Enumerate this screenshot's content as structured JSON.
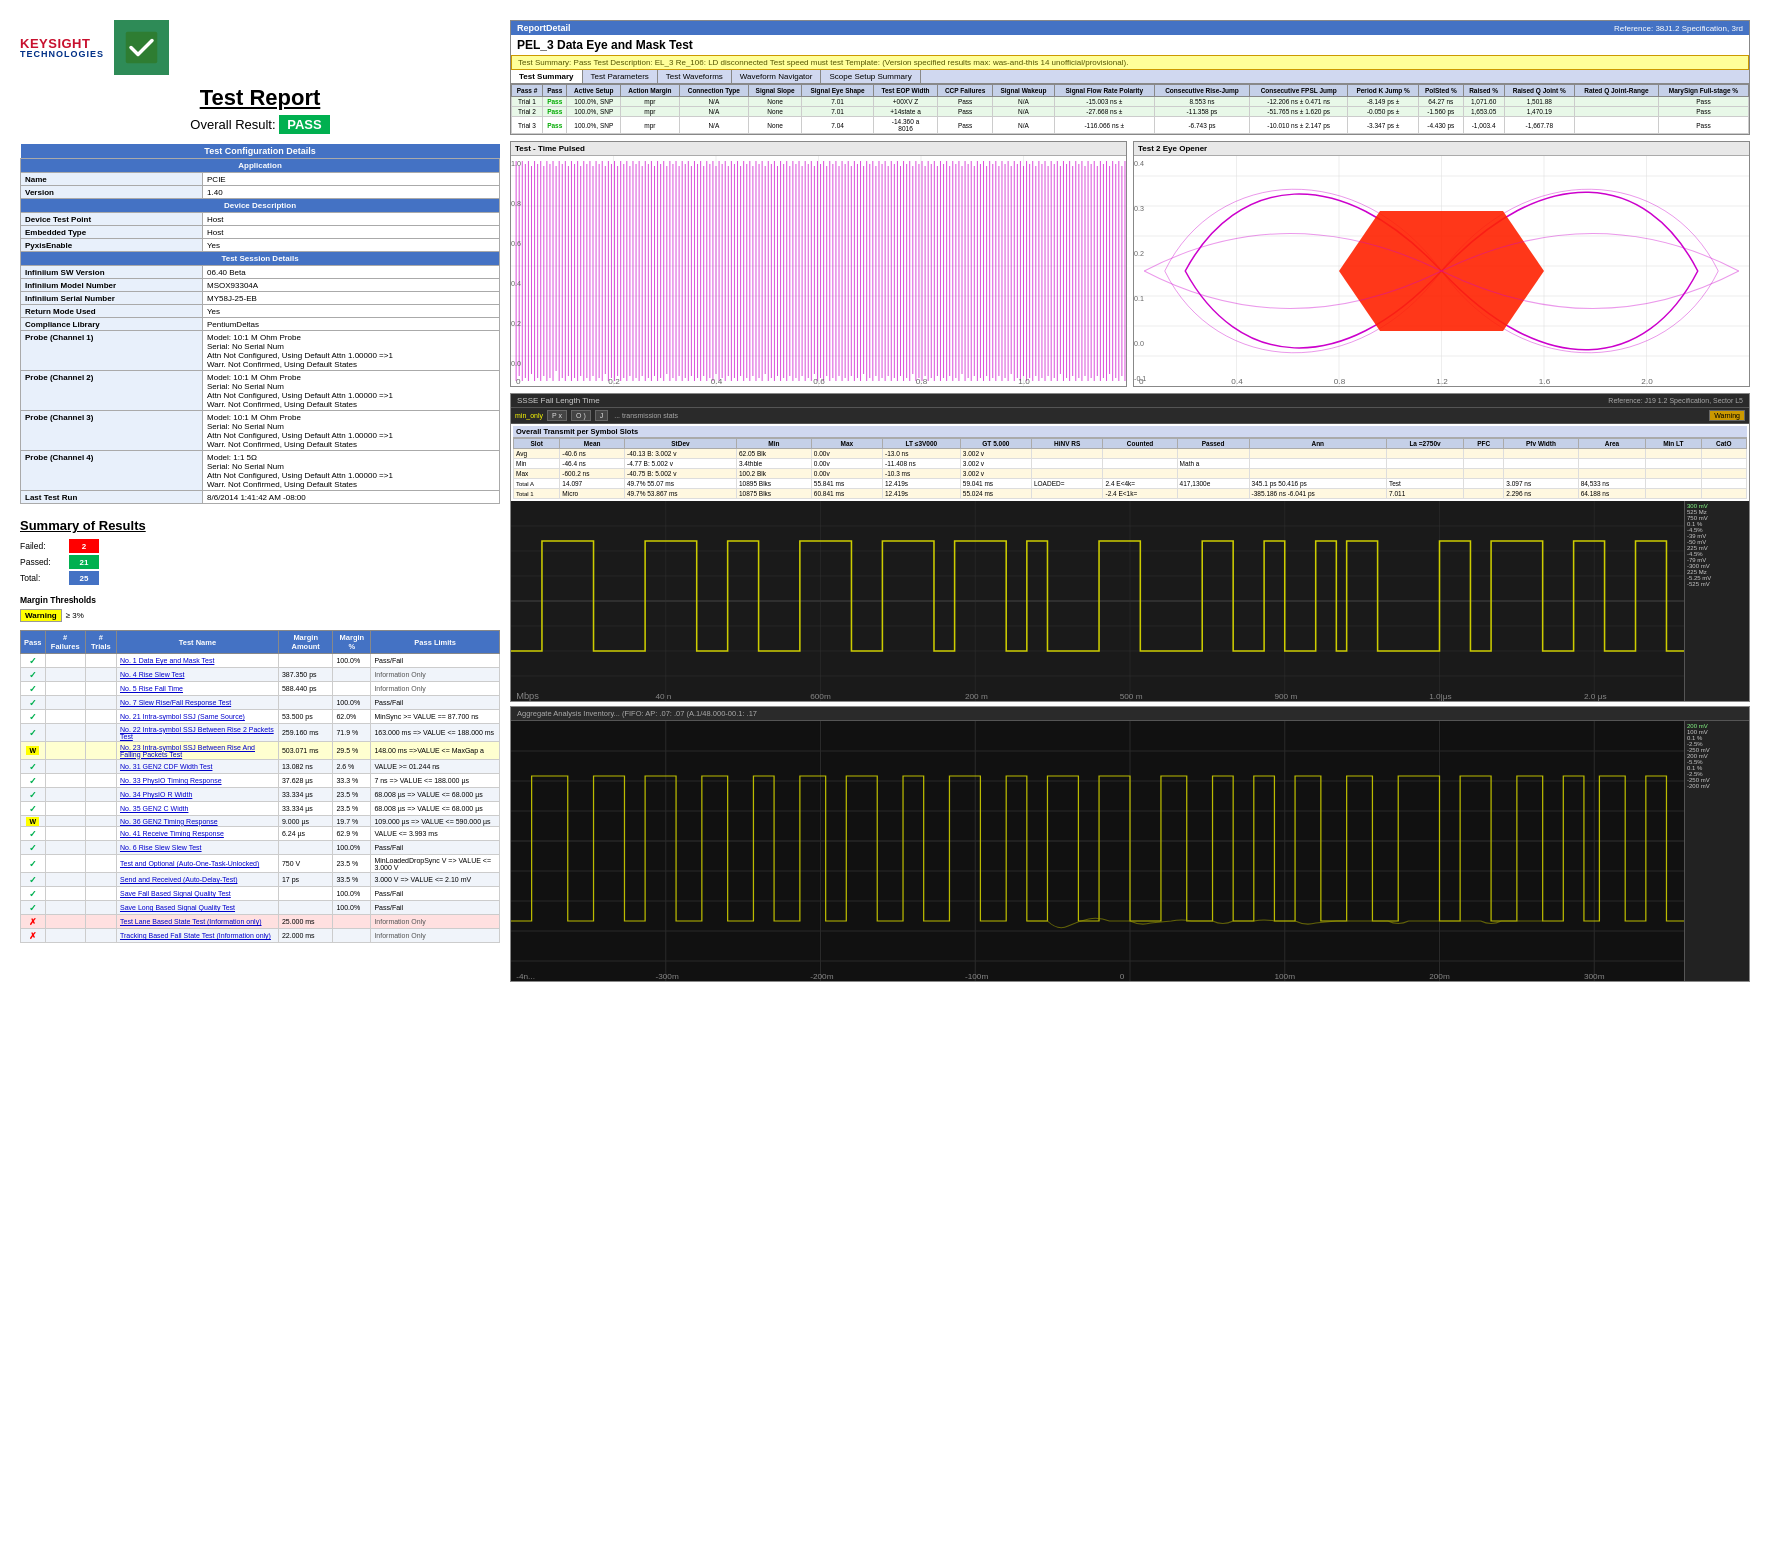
{
  "header": {
    "title": "Test Report",
    "overall_label": "Overall Result:",
    "overall_value": "PASS"
  },
  "config": {
    "table_header": "Test Configuration Details",
    "section_application": "Application",
    "fields": [
      {
        "label": "Name",
        "value": "PCIE"
      },
      {
        "label": "Version",
        "value": "1.40"
      },
      {
        "section": "Device Description"
      },
      {
        "label": "Device Test Point",
        "value": "Host"
      },
      {
        "label": "Embedded Type",
        "value": "Host"
      },
      {
        "label": "PyxisEnable",
        "value": "Yes"
      },
      {
        "section": "Test Session Details"
      },
      {
        "label": "Infiniium SW Version",
        "value": "06.40 Beta"
      },
      {
        "label": "Infiniium Model Number",
        "value": "MSOX93304A"
      },
      {
        "label": "Infiniium Serial Number",
        "value": "MY58J-25-EB"
      },
      {
        "label": "Return Mode Used",
        "value": "Yes"
      },
      {
        "label": "Compliance Library",
        "value": "PentiumDeltas"
      },
      {
        "label": "Probe (Channel 1)",
        "value": "Model: 10:1 M Ohm Probe\nSerial: No Serial Num\nAttn Not Configured, Using Default Attn 1.00000 =>1\nWarr. Not Confirmed, Using Default States"
      },
      {
        "label": "Probe (Channel 2)",
        "value": "Model: 10:1 M Ohm Probe\nSerial: No Serial Num\nAttn Not Configured, Using Default Attn 1.00000 =>1\nWarr. Not Confirmed, Using Default States"
      },
      {
        "label": "Probe (Channel 3)",
        "value": "Model: 10:1 M Ohm Probe\nSerial: No Serial Num\nAttn Not Configured, Using Default Attn 1.00000 =>1\nWarr. Not Confirmed, Using Default States"
      },
      {
        "label": "Probe (Channel 4)",
        "value": "Model: 1:1 5Ω\nSerial: No Serial Num\nAttn Not Configured, Using Default Attn 1.00000 =>1\nWarr. Not Confirmed, Using Default States"
      },
      {
        "label": "Last Test Run",
        "value": "8/6/2014 1:41:42 AM -08:00"
      }
    ]
  },
  "summary": {
    "title": "Summary of Results",
    "counts": [
      {
        "label": "Failed:",
        "value": "2",
        "color": "red"
      },
      {
        "label": "Passed:",
        "value": "21",
        "color": "green"
      },
      {
        "label": "Total:",
        "value": "25",
        "color": "blue"
      }
    ],
    "margin_threshold_label": "Margin Thresholds",
    "warning_label": "Warning",
    "warning_pct": "≥ 3%"
  },
  "results_table": {
    "headers": [
      "Pass",
      "# Failures",
      "# Trials",
      "Test Name",
      "Margin Amount",
      "Margin %",
      "Pass Limits"
    ],
    "rows": [
      {
        "pass": "✓",
        "failures": "",
        "trials": "",
        "name": "No. 1 Data Eye and Mask Test",
        "margin_amt": "",
        "margin_pct": "100.0%",
        "limits": "Pass/Fail",
        "status": "pass"
      },
      {
        "pass": "✓",
        "failures": "",
        "trials": "",
        "name": "No. 4 Rise Slew Test",
        "margin_amt": "387.350 ps",
        "margin_pct": "",
        "limits": "Information Only",
        "status": "pass"
      },
      {
        "pass": "✓",
        "failures": "",
        "trials": "",
        "name": "No. 5 Rise Fall Time",
        "margin_amt": "588.440 ps",
        "margin_pct": "",
        "limits": "Information Only",
        "status": "pass"
      },
      {
        "pass": "✓",
        "failures": "",
        "trials": "",
        "name": "No. 7 Slew Rise/Fall Response Test",
        "margin_amt": "",
        "margin_pct": "100.0%",
        "limits": "Pass/Fail",
        "status": "pass"
      },
      {
        "pass": "✓",
        "failures": "",
        "trials": "",
        "name": "No. 21 Intra-symbol SSJ (Same Source)",
        "margin_amt": "53.500 ps",
        "margin_pct": "62.0%",
        "limits": "MinSync >= VALUE == 87.700 ns",
        "status": "pass"
      },
      {
        "pass": "✓",
        "failures": "",
        "trials": "",
        "name": "No. 22 Intra-symbol SSJ Between Rise 2 Packets Test",
        "margin_amt": "259.160 ms",
        "margin_pct": "71.9 %",
        "limits": "163.000 ms => VALUE <= 188.000 ms",
        "status": "pass"
      },
      {
        "pass": "W",
        "failures": "",
        "trials": "",
        "name": "No. 23 Intra-symbol SSJ Between Rise And Falling Packets Test",
        "margin_amt": "503.071 ms",
        "margin_pct": "29.5 %",
        "limits": "148.00 ms =>VALUE <= MaxGap a",
        "status": "warn"
      },
      {
        "pass": "✓",
        "failures": "",
        "trials": "",
        "name": "No. 31 GEN2 CDF Width Test",
        "margin_amt": "13.082 ns",
        "margin_pct": "2.6 %",
        "limits": "VALUE >= 01.244 ns",
        "status": "pass"
      },
      {
        "pass": "✓",
        "failures": "",
        "trials": "",
        "name": "No. 33 PhysIO Timing Response",
        "margin_amt": "37.628 µs",
        "margin_pct": "33.3 %",
        "limits": "7 ns => VALUE <= 188.000 µs",
        "status": "pass"
      },
      {
        "pass": "✓",
        "failures": "",
        "trials": "",
        "name": "No. 34 PhysIO R Width",
        "margin_amt": "33.334 µs",
        "margin_pct": "23.5 %",
        "limits": "68.008 µs => VALUE <= 68.000 µs",
        "status": "pass"
      },
      {
        "pass": "✓",
        "failures": "",
        "trials": "",
        "name": "No. 35 GEN2 C Width",
        "margin_amt": "33.334 µs",
        "margin_pct": "23.5 %",
        "limits": "68.008 µs => VALUE <= 68.000 µs",
        "status": "pass"
      },
      {
        "pass": "W",
        "failures": "",
        "trials": "",
        "name": "No. 36 GEN2 Timing Response",
        "margin_amt": "9.000 µs",
        "margin_pct": "19.7 %",
        "limits": "109.000 µs => VALUE <= 590.000 µs",
        "status": "warn"
      },
      {
        "pass": "✓",
        "failures": "",
        "trials": "",
        "name": "No. 41 Receive Timing Response",
        "margin_amt": "6.24 µs",
        "margin_pct": "62.9 %",
        "limits": "VALUE <= 3.993 ms",
        "status": "pass"
      },
      {
        "pass": "✓",
        "failures": "",
        "trials": "",
        "name": "No. 6 Rise Slew Slew Test",
        "margin_amt": "",
        "margin_pct": "100.0%",
        "limits": "Pass/Fail",
        "status": "pass"
      },
      {
        "pass": "✓",
        "failures": "",
        "trials": "",
        "name": "Test and Optional (Auto-One-Task-Unlocked)",
        "margin_amt": "750 V",
        "margin_pct": "23.5 %",
        "limits": "MinLoadedDropSync V => VALUE <= 3.000 V",
        "status": "pass"
      },
      {
        "pass": "✓",
        "failures": "",
        "trials": "",
        "name": "Send and Received (Auto-Delay-Test)",
        "margin_amt": "17 ps",
        "margin_pct": "33.5 %",
        "limits": "3.000 V => VALUE <= 2.10 mV",
        "status": "pass"
      },
      {
        "pass": "✓",
        "failures": "",
        "trials": "",
        "name": "Save Fall Based Signal Quality Test",
        "margin_amt": "",
        "margin_pct": "100.0%",
        "limits": "Pass/Fail",
        "status": "pass"
      },
      {
        "pass": "✓",
        "failures": "",
        "trials": "",
        "name": "Save Long Based Signal Quality Test",
        "margin_amt": "",
        "margin_pct": "100.0%",
        "limits": "Pass/Fail",
        "status": "pass"
      },
      {
        "pass": "X",
        "failures": "",
        "trials": "",
        "name": "Test Lane Based State Test (Information only)",
        "margin_amt": "25.000 ms",
        "margin_pct": "",
        "limits": "Information Only",
        "status": "fail"
      },
      {
        "pass": "X",
        "failures": "",
        "trials": "",
        "name": "Tracking Based Fall State Test (Information only)",
        "margin_amt": "22.000 ms",
        "margin_pct": "",
        "limits": "Information Only",
        "status": "fail"
      }
    ]
  },
  "report_detail": {
    "title": "ReportDetail",
    "tab_title": "PEL_3 Data Eye and Mask Test",
    "reference": "Reference: 38J1.2 Specification, 3rd",
    "info_bar": "Test Summary:  Pass  Test Description: EL_3 Re_106: LD disconnected Test speed must test Template: (Version specified results max: was-and-this 14 unofficial/provisional).",
    "tabs": [
      "Test Summary",
      "Test Parameters",
      "Test Waveforms",
      "Waveform Navigator",
      "Scope Setup Summary"
    ],
    "active_tab": "Test Summary",
    "data_table_headers": [
      "Pass #",
      "Pass",
      "Active Setup",
      "Action Margin",
      "Connection Type",
      "Signal Slope",
      "Signal Eye Shape",
      "Test EOP Width",
      "CCP Failures",
      "Signal Wakeup",
      "Signal Flow Rate Polarity",
      "Consecutive Rise-Jump",
      "Consecutive FPSL Jump",
      "Period K Jump %",
      "PolSted %",
      "Raised %",
      "Raised Q Joint %",
      "Rated Q Joint-Range",
      "MarySign Full-stage %"
    ],
    "rows": [
      {
        "pass": "Pass",
        "pct": "100.0%",
        "setup": "SNP"
      },
      {
        "pass": "Pass",
        "pct": "100.0%",
        "setup": "SNP"
      },
      {
        "pass": "Pass",
        "pct": "100.0%",
        "setup": ""
      }
    ]
  },
  "eye_diagram": {
    "left_label": "Test - Time Pulsed",
    "right_label": "Test 2 Eye Opener"
  },
  "scope_panel": {
    "title": "SSSE Fall Length Time",
    "reference": "Reference: J19 1.2 Specification, Sector L5",
    "controls": [
      "min_only",
      "P x",
      "O )",
      "J"
    ],
    "stats_title": "Overall Transmit per Symbol Slots",
    "measurements": [
      {
        "label": "300 mV"
      },
      {
        "label": "525 Mz"
      },
      {
        "label": "750 mV"
      },
      {
        "label": "0.1 %"
      },
      {
        "label": "-4.5%"
      },
      {
        "label": "-39 mV"
      },
      {
        "label": "-50 mV"
      },
      {
        "label": "225 mV"
      },
      {
        "label": "-4.5%"
      },
      {
        "label": "-79 mV"
      },
      {
        "label": "-300 mV"
      },
      {
        "label": "225 Mz"
      },
      {
        "label": "-5.25 mV"
      },
      {
        "label": "-525 mV"
      }
    ]
  },
  "waveform_panel": {
    "title": "Aggregate Analysis  Inventory... (FIFO: AP: .07: .07 (A.1/48.000-00.1: .17",
    "measurements_right": [
      {
        "label": "200 mV"
      },
      {
        "label": "100 mV"
      },
      {
        "label": "0.1 %"
      },
      {
        "label": "-2.5%"
      },
      {
        "label": "-250 mV"
      },
      {
        "label": "200 mV"
      },
      {
        "label": "-5.5%"
      },
      {
        "label": "0.1 %"
      },
      {
        "label": "-2.5%"
      },
      {
        "label": "-250 mV"
      },
      {
        "label": "-200 mV"
      }
    ]
  }
}
